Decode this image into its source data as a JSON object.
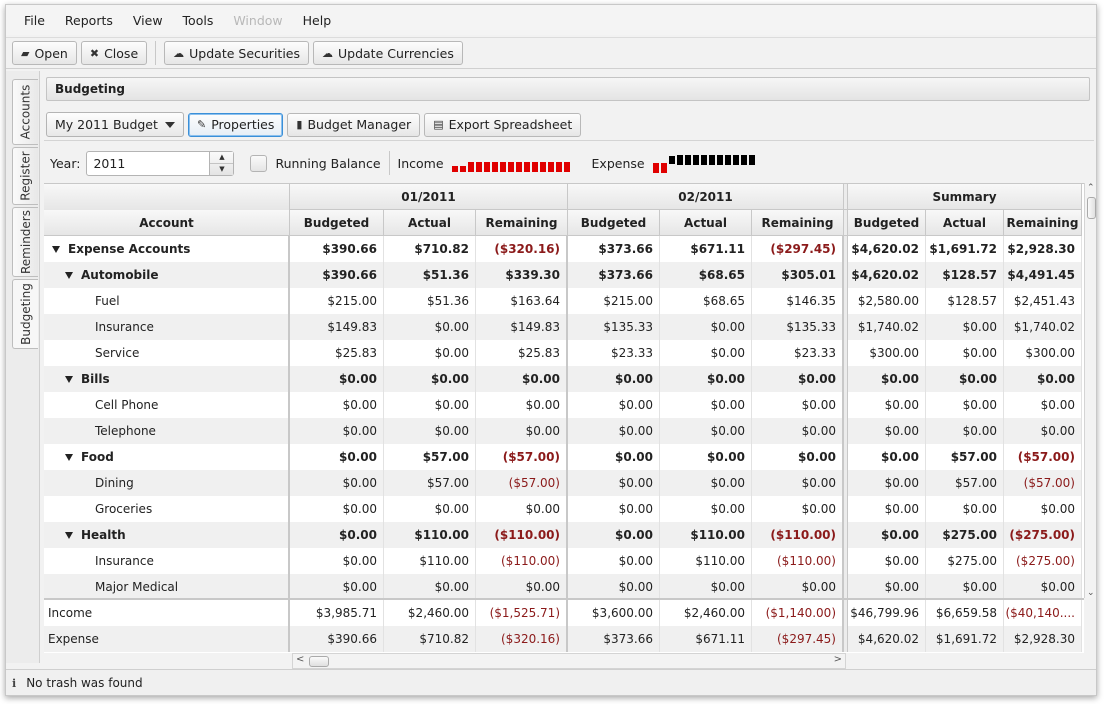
{
  "menubar": {
    "items": [
      "File",
      "Reports",
      "View",
      "Tools",
      "Window",
      "Help"
    ]
  },
  "toolbar": {
    "open_label": "Open",
    "close_label": "Close",
    "update_securities_label": "Update Securities",
    "update_currencies_label": "Update Currencies"
  },
  "side_tabs": [
    "Accounts",
    "Register",
    "Reminders",
    "Budgeting"
  ],
  "panel": {
    "title": "Budgeting"
  },
  "budget_toolbar": {
    "budget_selected": "My 2011 Budget",
    "properties_label": "Properties",
    "budget_manager_label": "Budget Manager",
    "export_label": "Export Spreadsheet"
  },
  "filters": {
    "year_label": "Year:",
    "year_value": "2011",
    "running_balance_label": "Running Balance",
    "income_label": "Income",
    "expense_label": "Expense"
  },
  "sparklines": {
    "income": {
      "color": "#e00000",
      "levels": [
        0.35,
        0.35,
        0.6,
        0.6,
        0.6,
        0.6,
        0.6,
        0.6,
        0.6,
        0.6,
        0.6,
        0.6,
        0.6,
        0.6,
        0.6
      ]
    },
    "expense": {
      "color_neg": "#e00000",
      "color_pos": "#000000",
      "levels": [
        -0.6,
        -0.6,
        0.5,
        0.6,
        0.6,
        0.6,
        0.6,
        0.6,
        0.6,
        0.6,
        0.6,
        0.6,
        0.6
      ]
    }
  },
  "table": {
    "period_headers": [
      "01/2011",
      "02/2011",
      "Summary"
    ],
    "account_header": "Account",
    "sub_headers": [
      "Budgeted",
      "Actual",
      "Remaining"
    ],
    "rows": [
      {
        "name": "Expense Accounts",
        "level": 0,
        "bold": true,
        "expand": true,
        "vals": [
          "$390.66",
          "$710.82",
          "($320.16)",
          "$373.66",
          "$671.11",
          "($297.45)",
          "$4,620.02",
          "$1,691.72",
          "$2,928.30"
        ]
      },
      {
        "name": "Automobile",
        "level": 1,
        "bold": true,
        "expand": true,
        "vals": [
          "$390.66",
          "$51.36",
          "$339.30",
          "$373.66",
          "$68.65",
          "$305.01",
          "$4,620.02",
          "$128.57",
          "$4,491.45"
        ]
      },
      {
        "name": "Fuel",
        "level": 2,
        "bold": false,
        "expand": false,
        "vals": [
          "$215.00",
          "$51.36",
          "$163.64",
          "$215.00",
          "$68.65",
          "$146.35",
          "$2,580.00",
          "$128.57",
          "$2,451.43"
        ]
      },
      {
        "name": "Insurance",
        "level": 2,
        "bold": false,
        "expand": false,
        "vals": [
          "$149.83",
          "$0.00",
          "$149.83",
          "$135.33",
          "$0.00",
          "$135.33",
          "$1,740.02",
          "$0.00",
          "$1,740.02"
        ]
      },
      {
        "name": "Service",
        "level": 2,
        "bold": false,
        "expand": false,
        "vals": [
          "$25.83",
          "$0.00",
          "$25.83",
          "$23.33",
          "$0.00",
          "$23.33",
          "$300.00",
          "$0.00",
          "$300.00"
        ]
      },
      {
        "name": "Bills",
        "level": 1,
        "bold": true,
        "expand": true,
        "vals": [
          "$0.00",
          "$0.00",
          "$0.00",
          "$0.00",
          "$0.00",
          "$0.00",
          "$0.00",
          "$0.00",
          "$0.00"
        ]
      },
      {
        "name": "Cell Phone",
        "level": 2,
        "bold": false,
        "expand": false,
        "vals": [
          "$0.00",
          "$0.00",
          "$0.00",
          "$0.00",
          "$0.00",
          "$0.00",
          "$0.00",
          "$0.00",
          "$0.00"
        ]
      },
      {
        "name": "Telephone",
        "level": 2,
        "bold": false,
        "expand": false,
        "vals": [
          "$0.00",
          "$0.00",
          "$0.00",
          "$0.00",
          "$0.00",
          "$0.00",
          "$0.00",
          "$0.00",
          "$0.00"
        ]
      },
      {
        "name": "Food",
        "level": 1,
        "bold": true,
        "expand": true,
        "vals": [
          "$0.00",
          "$57.00",
          "($57.00)",
          "$0.00",
          "$0.00",
          "$0.00",
          "$0.00",
          "$57.00",
          "($57.00)"
        ]
      },
      {
        "name": "Dining",
        "level": 2,
        "bold": false,
        "expand": false,
        "vals": [
          "$0.00",
          "$57.00",
          "($57.00)",
          "$0.00",
          "$0.00",
          "$0.00",
          "$0.00",
          "$57.00",
          "($57.00)"
        ]
      },
      {
        "name": "Groceries",
        "level": 2,
        "bold": false,
        "expand": false,
        "vals": [
          "$0.00",
          "$0.00",
          "$0.00",
          "$0.00",
          "$0.00",
          "$0.00",
          "$0.00",
          "$0.00",
          "$0.00"
        ]
      },
      {
        "name": "Health",
        "level": 1,
        "bold": true,
        "expand": true,
        "vals": [
          "$0.00",
          "$110.00",
          "($110.00)",
          "$0.00",
          "$110.00",
          "($110.00)",
          "$0.00",
          "$275.00",
          "($275.00)"
        ]
      },
      {
        "name": "Insurance",
        "level": 2,
        "bold": false,
        "expand": false,
        "vals": [
          "$0.00",
          "$110.00",
          "($110.00)",
          "$0.00",
          "$110.00",
          "($110.00)",
          "$0.00",
          "$275.00",
          "($275.00)"
        ]
      },
      {
        "name": "Major Medical",
        "level": 2,
        "bold": false,
        "expand": false,
        "vals": [
          "$0.00",
          "$0.00",
          "$0.00",
          "$0.00",
          "$0.00",
          "$0.00",
          "$0.00",
          "$0.00",
          "$0.00"
        ]
      }
    ],
    "footer_rows": [
      {
        "name": "Income",
        "vals": [
          "$3,985.71",
          "$2,460.00",
          "($1,525.71)",
          "$3,600.00",
          "$2,460.00",
          "($1,140.00)",
          "$46,799.96",
          "$6,659.58",
          "($40,140...."
        ]
      },
      {
        "name": "Expense",
        "vals": [
          "$390.66",
          "$710.82",
          "($320.16)",
          "$373.66",
          "$671.11",
          "($297.45)",
          "$4,620.02",
          "$1,691.72",
          "$2,928.30"
        ]
      }
    ]
  },
  "status": {
    "message": "No trash was found"
  }
}
